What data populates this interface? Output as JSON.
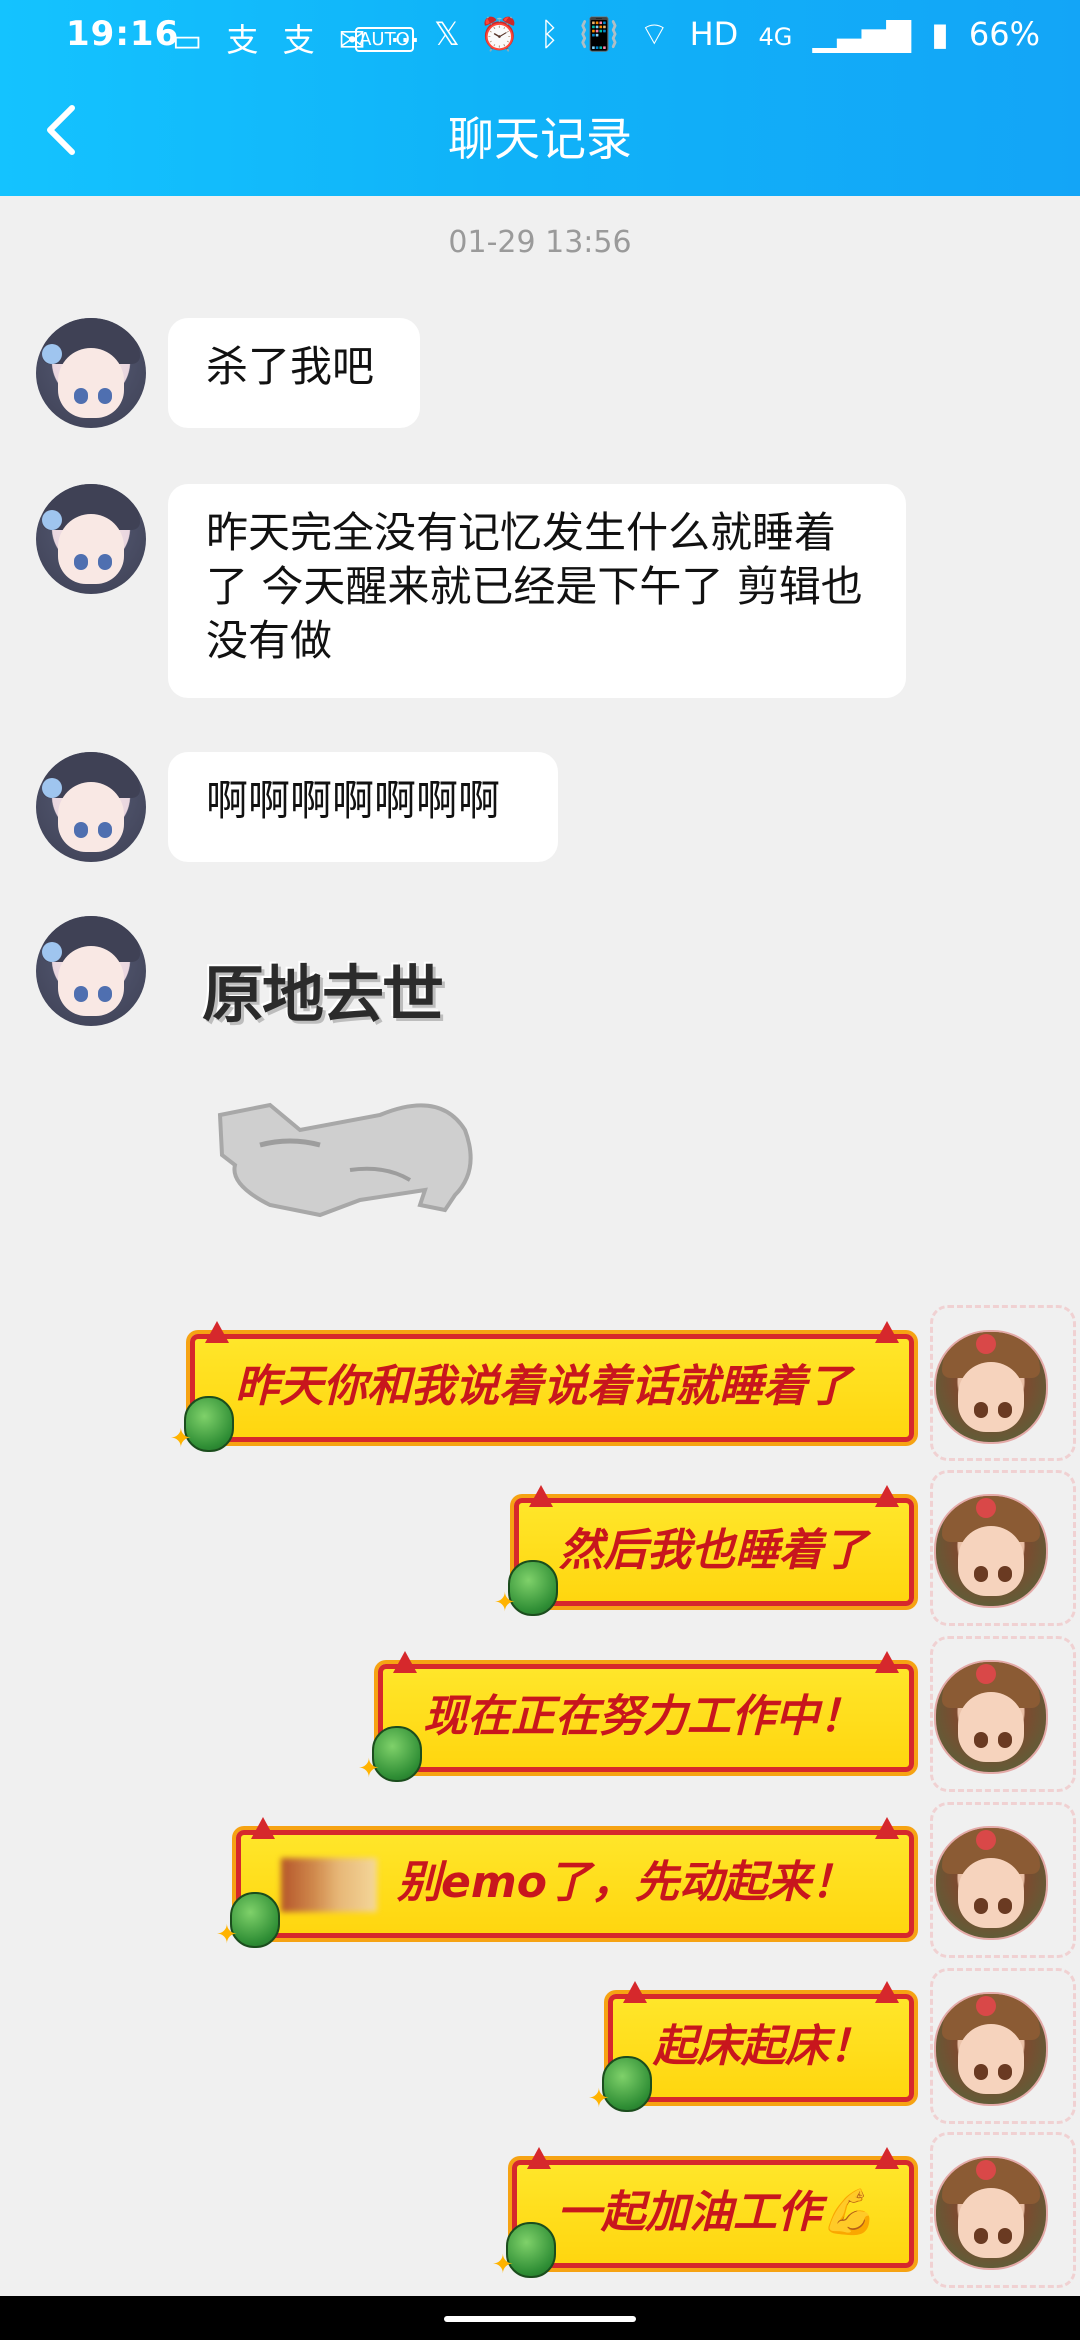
{
  "status_bar": {
    "time": "19:16",
    "icons_left": [
      "video-icon",
      "alipay-icon",
      "alipay-icon",
      "mail-icon",
      "more-icon"
    ],
    "icons_right": [
      "auto-hz-icon",
      "x-icon",
      "alarm-icon",
      "bluetooth-icon",
      "vibrate-icon",
      "wifi-icon"
    ],
    "hd": "HD",
    "network": "4G",
    "battery": "66%"
  },
  "header": {
    "title": "聊天记录"
  },
  "timestamp": "01-29 13:56",
  "messages_left": [
    {
      "text": "杀了我吧"
    },
    {
      "text": "昨天完全没有记忆发生什么就睡着了 今天醒来就已经是下午了 剪辑也没有做"
    },
    {
      "text": "啊啊啊啊啊啊啊"
    }
  ],
  "sticker": {
    "text": "原地去世",
    "image": "sleeping-cat"
  },
  "messages_right": [
    {
      "text": "昨天你和我说着说着话就睡着了"
    },
    {
      "text": "然后我也睡着了"
    },
    {
      "text": "现在正在努力工作中！"
    },
    {
      "text": "别emo了，先动起来！"
    },
    {
      "text": "起床起床！"
    },
    {
      "text": "一起加油工作💪"
    }
  ],
  "colors": {
    "header_bg": "#10b3f8",
    "banner_fill": "#ffe62a",
    "banner_text": "#c8161d",
    "banner_border": "#d6282c"
  }
}
